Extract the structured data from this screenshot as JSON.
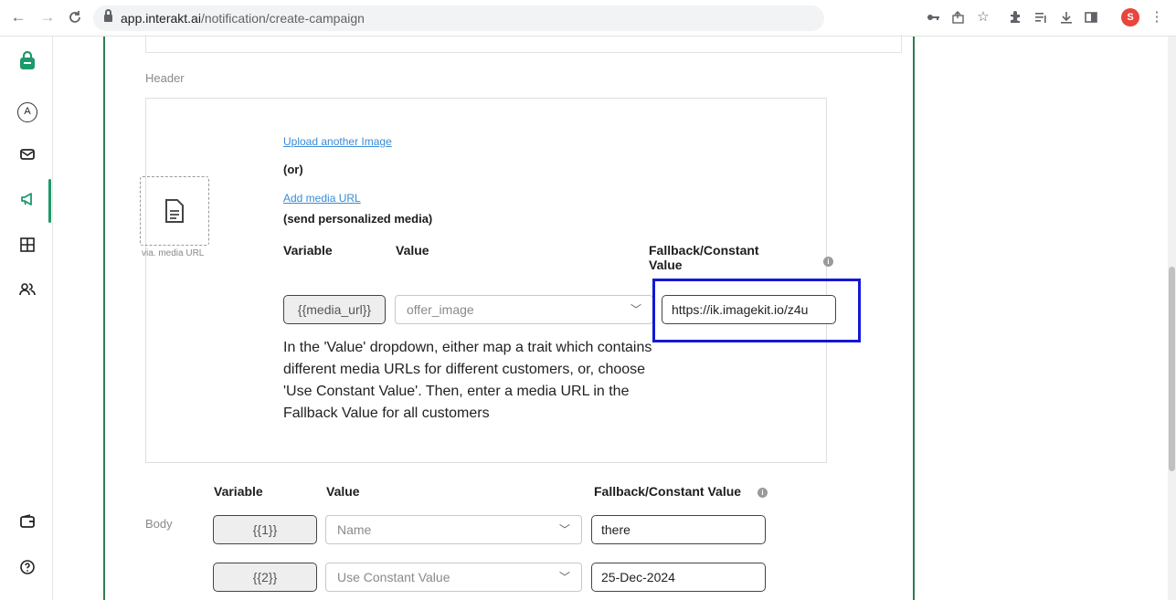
{
  "browser": {
    "url_domain": "app.interakt.ai",
    "url_path": "/notification/create-campaign",
    "profile_initial": "S",
    "icons": {
      "back": "←",
      "forward": "→",
      "reload": "C",
      "key": "key-icon",
      "share": "share-icon",
      "star": "☆",
      "extensions": "puzzle-icon",
      "reading_list": "list-icon",
      "download": "download-icon",
      "side_panel": "panel-icon",
      "menu": "⋮"
    }
  },
  "sidebar": {
    "items": [
      {
        "name": "bag-logo-icon"
      },
      {
        "name": "avatar",
        "label": "A"
      },
      {
        "name": "mail-icon"
      },
      {
        "name": "megaphone-icon"
      },
      {
        "name": "grid-icon"
      },
      {
        "name": "users-icon"
      },
      {
        "name": "wallet-icon"
      },
      {
        "name": "help-icon"
      }
    ]
  },
  "header_section": {
    "label": "Header",
    "upload_link": "Upload another Image",
    "or_text": "(or)",
    "add_media_link": "Add media URL",
    "personalized_text": "(send personalized media)",
    "col_variable": "Variable",
    "col_value": "Value",
    "col_fallback_line1": "Fallback/Constant",
    "col_fallback_line2": "Value",
    "thumb_caption": "via. media URL",
    "row": {
      "variable": "{{media_url}}",
      "value": "offer_image",
      "fallback": "https://ik.imagekit.io/z4u"
    },
    "description": "In the 'Value' dropdown, either map a trait which contains different media URLs for different customers, or, choose 'Use Constant Value'. Then, enter a media URL in the Fallback Value for all customers"
  },
  "body_section": {
    "label": "Body",
    "col_variable": "Variable",
    "col_value": "Value",
    "col_fallback": "Fallback/Constant Value",
    "rows": [
      {
        "variable": "{{1}}",
        "value": "Name",
        "fallback": "there"
      },
      {
        "variable": "{{2}}",
        "value": "Use Constant Value",
        "fallback": "25-Dec-2024"
      }
    ]
  },
  "colors": {
    "panel_border": "#2e7d4f",
    "active_accent": "#1b9a6b",
    "link": "#3a8bd6",
    "highlight_box": "#1418d6",
    "profile": "#e8453c"
  }
}
